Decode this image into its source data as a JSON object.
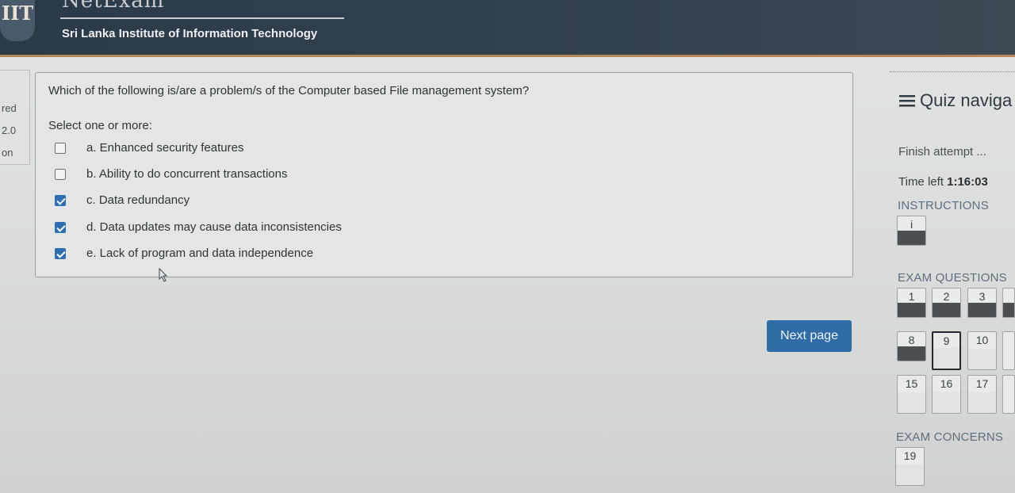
{
  "header": {
    "logo": "IIT",
    "brand": "NetExam",
    "institution": "Sri Lanka Institute of Information Technology"
  },
  "question_info": {
    "status": "red",
    "mark": "2.0",
    "flag": "on"
  },
  "question": {
    "text": "Which of the following is/are a problem/s of the Computer based File management system?",
    "prompt": "Select one or more:",
    "options": [
      {
        "label": "a. Enhanced security features",
        "checked": false
      },
      {
        "label": "b. Ability to do concurrent transactions",
        "checked": false
      },
      {
        "label": "c. Data redundancy",
        "checked": true
      },
      {
        "label": "d. Data updates may cause data inconsistencies",
        "checked": true
      },
      {
        "label": "e. Lack of program and data independence",
        "checked": true
      }
    ]
  },
  "next_button": "Next page",
  "nav": {
    "title": "Quiz naviga",
    "menu_icon": "hamburger-icon",
    "finish": "Finish attempt ...",
    "time_label": "Time left",
    "time_value": "1:16:03",
    "instructions_heading": "INSTRUCTIONS",
    "instructions_items": [
      {
        "num": "i",
        "answered": true
      }
    ],
    "exam_heading": "EXAM QUESTIONS",
    "exam_items": [
      {
        "num": "1",
        "answered": true
      },
      {
        "num": "2",
        "answered": true
      },
      {
        "num": "3",
        "answered": true
      },
      {
        "num": "8",
        "answered": true
      },
      {
        "num": "9",
        "answered": false,
        "current": true
      },
      {
        "num": "10",
        "answered": false
      },
      {
        "num": "15",
        "answered": false
      },
      {
        "num": "16",
        "answered": false
      },
      {
        "num": "17",
        "answered": false
      }
    ],
    "concerns_heading": "EXAM CONCERNS",
    "concerns_items": [
      {
        "num": "19",
        "answered": false
      }
    ]
  },
  "colors": {
    "header_bg": "#2c3a48",
    "accent": "#2f6ca6",
    "answered_bar": "#4a4f53"
  }
}
